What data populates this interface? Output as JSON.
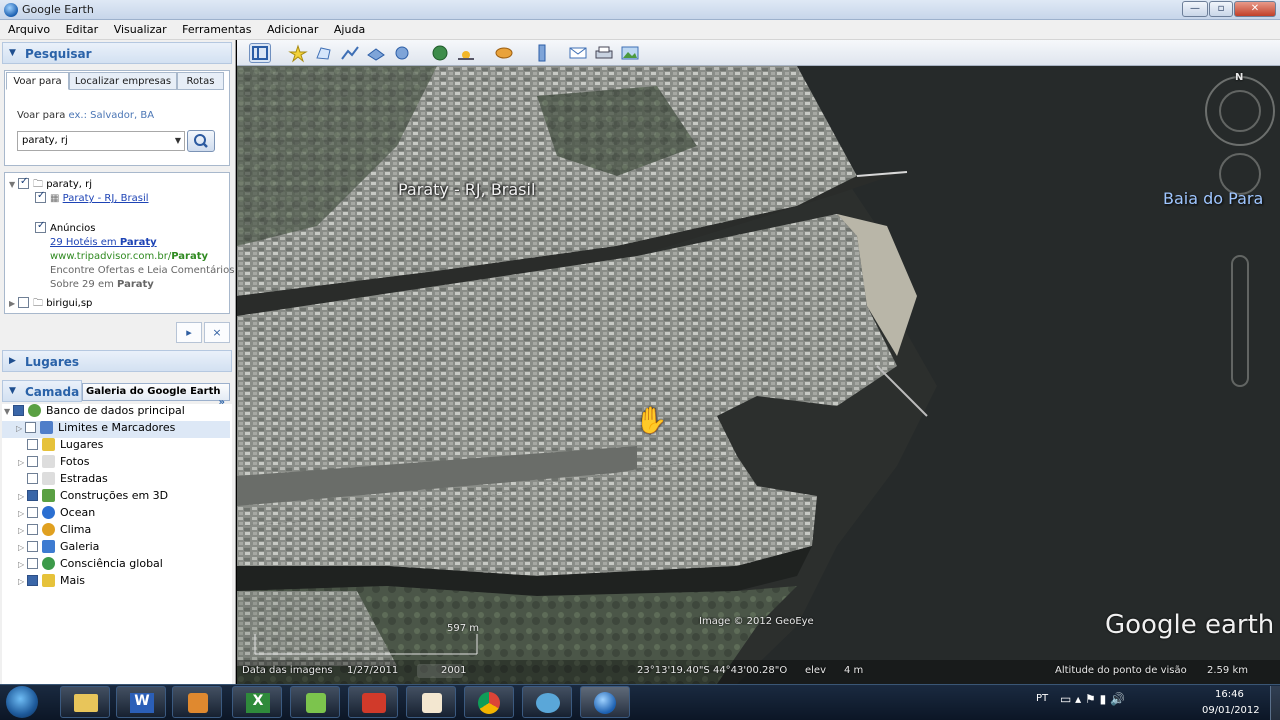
{
  "window": {
    "title": "Google Earth",
    "buttons": {
      "minimize": "—",
      "maximize": "▫",
      "close": "✕"
    }
  },
  "menu": [
    "Arquivo",
    "Editar",
    "Visualizar",
    "Ferramentas",
    "Adicionar",
    "Ajuda"
  ],
  "search_panel": {
    "header": "Pesquisar",
    "tabs": [
      "Voar para",
      "Localizar empresas",
      "Rotas"
    ],
    "fly_to_label": "Voar para",
    "fly_to_example": "ex.: Salvador, BA",
    "input_value": "paraty, rj"
  },
  "results": {
    "root": "paraty, rj",
    "place_link": "Paraty - RJ, Brasil",
    "ads_label": "Anúncios",
    "ad_line1_prefix": "29 Hotéis em ",
    "ad_line1_bold": "Paraty",
    "ad_line2_prefix": "www.tripadvisor.com.br/",
    "ad_line2_bold": "Paraty",
    "ad_line3": "Encontre Ofertas e Leia Comentários",
    "ad_line4_prefix": "Sobre 29 em ",
    "ad_line4_bold": "Paraty",
    "second_search": "birigui,sp",
    "close_symbol": "×"
  },
  "places_panel": {
    "header": "Lugares"
  },
  "layers_panel": {
    "header": "Camada",
    "gallery_button": "Galeria do Google Earth",
    "gallery_arrow": "»",
    "items": [
      {
        "label": "Banco de dados principal",
        "icon": "database-icon",
        "color": "#5aa043"
      },
      {
        "label": "Limites e Marcadores",
        "icon": "flag-icon",
        "color": "#4f7ec9"
      },
      {
        "label": "Lugares",
        "icon": "places-icon",
        "color": "#e6c23a"
      },
      {
        "label": "Fotos",
        "icon": "photo-icon",
        "color": "#cccccc"
      },
      {
        "label": "Estradas",
        "icon": "road-icon",
        "color": "#cccccc"
      },
      {
        "label": "Construções em 3D",
        "icon": "building-3d-icon",
        "color": "#5aa043"
      },
      {
        "label": "Ocean",
        "icon": "ocean-icon",
        "color": "#2b6fd1"
      },
      {
        "label": "Clima",
        "icon": "weather-icon",
        "color": "#e0a020"
      },
      {
        "label": "Galeria",
        "icon": "gallery-icon",
        "color": "#3d7bd1"
      },
      {
        "label": "Consciência global",
        "icon": "globe-icon",
        "color": "#3c9a4a"
      },
      {
        "label": "Mais",
        "icon": "more-icon",
        "color": "#e6c23a"
      }
    ]
  },
  "map": {
    "place_label": "Paraty - RJ, Brasil",
    "bay_label": "Baia do Para",
    "north_label": "N",
    "scale_label": "597 m",
    "imagery_credit": "Image © 2012 GeoEye",
    "logo": "Google earth",
    "imagery_date_label": "Data das imagens",
    "imagery_date": "1/27/2011",
    "history_year": "2001",
    "coordinates": "23°13'19.40\"S  44°43'00.28\"O",
    "elev_label": "elev",
    "elev_value": "4 m",
    "eye_alt_label": "Altitude do ponto de visão",
    "eye_alt_value": "2.59 km"
  },
  "taskbar": {
    "language": "PT",
    "time": "16:46",
    "date": "09/01/2012",
    "apps": [
      "explorer-icon",
      "word-icon",
      "media-player-icon",
      "excel-icon",
      "app-green-icon",
      "camera-icon",
      "paint-icon",
      "chrome-icon",
      "messenger-icon",
      "google-earth-icon"
    ]
  }
}
